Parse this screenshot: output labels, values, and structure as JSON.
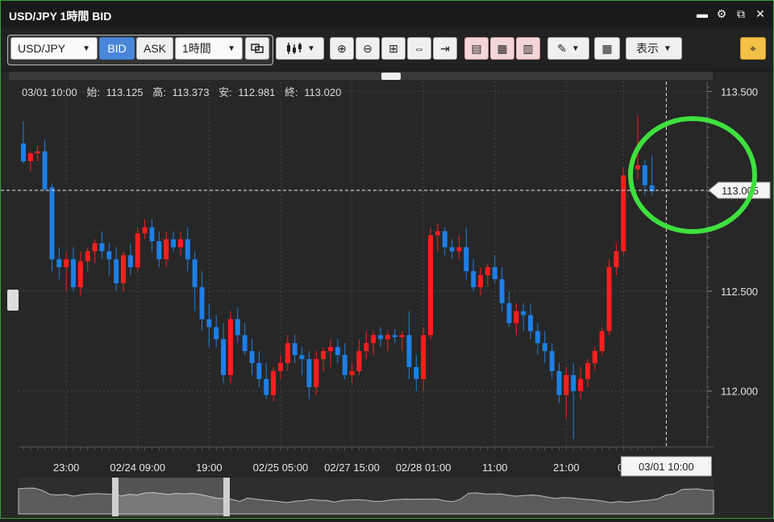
{
  "window": {
    "title": "USD/JPY 1時間 BID"
  },
  "toolbar": {
    "symbol": "USD/JPY",
    "bid_label": "BID",
    "ask_label": "ASK",
    "timeframe": "1時間",
    "display_label": "表示"
  },
  "ohlc": {
    "time": "03/01 10:00",
    "open_label": "始:",
    "open": "113.125",
    "high_label": "高:",
    "high": "113.373",
    "low_label": "安:",
    "low": "112.981",
    "close_label": "終:",
    "close": "113.020"
  },
  "crosshair": {
    "time_label": "03/01 10:00"
  },
  "colors": {
    "up": "#ff1e1e",
    "down": "#1e7fe6",
    "highlight": "#3ee03e",
    "background": "#272727"
  },
  "chart_data": {
    "type": "candlestick",
    "ylim": [
      111.72,
      113.55
    ],
    "y_ticks": [
      "113.500",
      "113.000",
      "112.500",
      "112.000"
    ],
    "y_tick_values": [
      113.5,
      113.0,
      112.5,
      112.0
    ],
    "x_ticks": [
      {
        "index": 6,
        "label": "23:00"
      },
      {
        "index": 16,
        "label": "02/24 09:00"
      },
      {
        "index": 26,
        "label": "19:00"
      },
      {
        "index": 36,
        "label": "02/25 05:00"
      },
      {
        "index": 46,
        "label": "02/27 15:00"
      },
      {
        "index": 56,
        "label": "02/28 01:00"
      },
      {
        "index": 66,
        "label": "11:00"
      },
      {
        "index": 76,
        "label": "21:00"
      },
      {
        "index": 84,
        "label": "03"
      }
    ],
    "price_marker": "113.005",
    "crosshair_price": 113.005,
    "crosshair_index": 90,
    "candles": [
      [
        113.24,
        113.35,
        113.14,
        113.15
      ],
      [
        113.15,
        113.2,
        113.1,
        113.19
      ],
      [
        113.19,
        113.23,
        113.15,
        113.2
      ],
      [
        113.2,
        113.26,
        113.0,
        113.01
      ],
      [
        113.02,
        113.04,
        112.6,
        112.66
      ],
      [
        112.66,
        112.72,
        112.56,
        112.62
      ],
      [
        112.62,
        112.7,
        112.5,
        112.66
      ],
      [
        112.66,
        112.72,
        112.5,
        112.52
      ],
      [
        112.52,
        112.7,
        112.48,
        112.65
      ],
      [
        112.65,
        112.72,
        112.6,
        112.7
      ],
      [
        112.7,
        112.76,
        112.64,
        112.74
      ],
      [
        112.74,
        112.8,
        112.66,
        112.7
      ],
      [
        112.7,
        112.74,
        112.58,
        112.66
      ],
      [
        112.66,
        112.72,
        112.5,
        112.54
      ],
      [
        112.54,
        112.7,
        112.5,
        112.68
      ],
      [
        112.68,
        112.74,
        112.58,
        112.62
      ],
      [
        112.62,
        112.82,
        112.6,
        112.79
      ],
      [
        112.79,
        112.86,
        112.76,
        112.82
      ],
      [
        112.82,
        112.86,
        112.7,
        112.75
      ],
      [
        112.75,
        112.8,
        112.62,
        112.66
      ],
      [
        112.66,
        112.8,
        112.62,
        112.76
      ],
      [
        112.76,
        112.8,
        112.7,
        112.72
      ],
      [
        112.72,
        112.8,
        112.68,
        112.76
      ],
      [
        112.76,
        112.82,
        112.6,
        112.66
      ],
      [
        112.66,
        112.7,
        112.4,
        112.52
      ],
      [
        112.52,
        112.6,
        112.3,
        112.36
      ],
      [
        112.36,
        112.44,
        112.22,
        112.32
      ],
      [
        112.32,
        112.38,
        112.22,
        112.26
      ],
      [
        112.26,
        112.34,
        112.04,
        112.08
      ],
      [
        112.08,
        112.4,
        112.04,
        112.36
      ],
      [
        112.36,
        112.42,
        112.24,
        112.28
      ],
      [
        112.28,
        112.34,
        112.18,
        112.2
      ],
      [
        112.2,
        112.26,
        112.08,
        112.14
      ],
      [
        112.14,
        112.2,
        112.02,
        112.06
      ],
      [
        112.06,
        112.14,
        111.96,
        111.98
      ],
      [
        111.98,
        112.12,
        111.95,
        112.1
      ],
      [
        112.1,
        112.18,
        112.06,
        112.14
      ],
      [
        112.14,
        112.28,
        112.1,
        112.24
      ],
      [
        112.24,
        112.28,
        112.14,
        112.18
      ],
      [
        112.18,
        112.22,
        112.08,
        112.16
      ],
      [
        112.16,
        112.2,
        111.96,
        112.02
      ],
      [
        112.02,
        112.2,
        111.98,
        112.16
      ],
      [
        112.16,
        112.22,
        112.1,
        112.2
      ],
      [
        112.2,
        112.26,
        112.12,
        112.22
      ],
      [
        112.22,
        112.26,
        112.14,
        112.18
      ],
      [
        112.18,
        112.24,
        112.06,
        112.08
      ],
      [
        112.08,
        112.14,
        112.04,
        112.1
      ],
      [
        112.1,
        112.26,
        112.08,
        112.2
      ],
      [
        112.2,
        112.3,
        112.16,
        112.24
      ],
      [
        112.24,
        112.3,
        112.18,
        112.28
      ],
      [
        112.28,
        112.32,
        112.22,
        112.26
      ],
      [
        112.26,
        112.3,
        112.2,
        112.28
      ],
      [
        112.28,
        112.31,
        112.24,
        112.27
      ],
      [
        112.27,
        112.3,
        112.2,
        112.28
      ],
      [
        112.28,
        112.4,
        112.06,
        112.12
      ],
      [
        112.12,
        112.18,
        112.0,
        112.06
      ],
      [
        112.06,
        112.32,
        112.0,
        112.28
      ],
      [
        112.28,
        112.82,
        112.26,
        112.78
      ],
      [
        112.78,
        112.84,
        112.7,
        112.8
      ],
      [
        112.8,
        112.82,
        112.68,
        112.72
      ],
      [
        112.72,
        112.76,
        112.66,
        112.7
      ],
      [
        112.7,
        112.78,
        112.66,
        112.72
      ],
      [
        112.72,
        112.82,
        112.56,
        112.6
      ],
      [
        112.6,
        112.66,
        112.5,
        112.52
      ],
      [
        112.52,
        112.62,
        112.48,
        112.58
      ],
      [
        112.58,
        112.64,
        112.52,
        112.62
      ],
      [
        112.62,
        112.68,
        112.54,
        112.56
      ],
      [
        112.56,
        112.62,
        112.4,
        112.44
      ],
      [
        112.44,
        112.5,
        112.32,
        112.34
      ],
      [
        112.34,
        112.44,
        112.28,
        112.4
      ],
      [
        112.4,
        112.44,
        112.3,
        112.38
      ],
      [
        112.38,
        112.44,
        112.26,
        112.3
      ],
      [
        112.3,
        112.34,
        112.18,
        112.24
      ],
      [
        112.24,
        112.3,
        112.14,
        112.2
      ],
      [
        112.2,
        112.24,
        112.06,
        112.1
      ],
      [
        112.1,
        112.14,
        111.94,
        111.98
      ],
      [
        111.98,
        112.12,
        111.86,
        112.08
      ],
      [
        112.08,
        112.14,
        111.76,
        112.0
      ],
      [
        112.0,
        112.12,
        111.96,
        112.06
      ],
      [
        112.06,
        112.16,
        112.02,
        112.14
      ],
      [
        112.14,
        112.22,
        112.1,
        112.2
      ],
      [
        112.2,
        112.32,
        112.18,
        112.3
      ],
      [
        112.3,
        112.66,
        112.28,
        112.62
      ],
      [
        112.62,
        112.74,
        112.58,
        112.7
      ],
      [
        112.7,
        113.12,
        112.68,
        113.08
      ],
      [
        113.08,
        113.16,
        113.0,
        113.11
      ],
      [
        113.11,
        113.38,
        113.06,
        113.13
      ],
      [
        113.13,
        113.16,
        112.98,
        113.03
      ],
      [
        113.03,
        113.18,
        112.98,
        113.0
      ]
    ]
  }
}
